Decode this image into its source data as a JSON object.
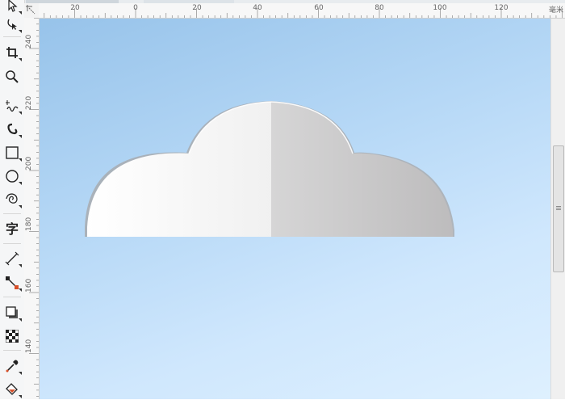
{
  "toolbox": {
    "tools": [
      {
        "name": "pick-tool",
        "icon": "arrow-pointer-icon"
      },
      {
        "name": "shape-tool",
        "icon": "node-edit-icon"
      },
      {
        "name": "crop-tool",
        "icon": "crop-icon"
      },
      {
        "name": "zoom-tool",
        "icon": "magnifier-icon"
      },
      {
        "name": "freehand-tool",
        "icon": "freehand-curve-icon"
      },
      {
        "name": "artistic-media-tool",
        "icon": "brush-stroke-icon"
      },
      {
        "name": "rectangle-tool",
        "icon": "rectangle-icon"
      },
      {
        "name": "ellipse-tool",
        "icon": "ellipse-icon"
      },
      {
        "name": "polygon-tool",
        "icon": "spiral-icon"
      },
      {
        "name": "text-tool",
        "icon": "text-char-icon",
        "glyph": "字"
      },
      {
        "name": "parallel-dimension-tool",
        "icon": "dimension-line-icon"
      },
      {
        "name": "connector-tool",
        "icon": "connector-icon"
      },
      {
        "name": "drop-shadow-tool",
        "icon": "drop-shadow-icon"
      },
      {
        "name": "transparency-tool",
        "icon": "checkerboard-icon"
      },
      {
        "name": "eyedropper-tool",
        "icon": "eyedropper-icon"
      },
      {
        "name": "interactive-fill-tool",
        "icon": "paint-bucket-icon"
      }
    ]
  },
  "ruler_h": {
    "labels": [
      "20",
      "0",
      "20",
      "40",
      "60",
      "80",
      "100",
      "120"
    ],
    "units": "毫米"
  },
  "ruler_v": {
    "labels": [
      "240",
      "220",
      "200",
      "180",
      "160",
      "140"
    ]
  },
  "canvas": {
    "background_top": "#97c3ea",
    "background_bottom": "#def0fe",
    "cloud_fill_light": "#ffffff",
    "cloud_fill_dark": "#bdbcbd"
  }
}
